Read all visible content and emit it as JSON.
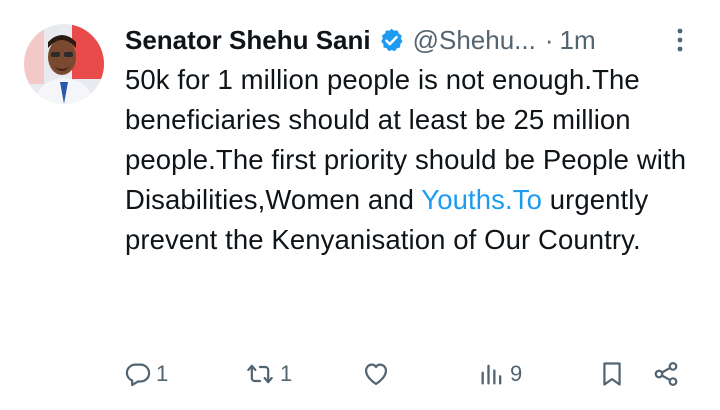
{
  "tweet": {
    "author_name": "Senator Shehu Sani",
    "handle": "@Shehu...",
    "separator": "·",
    "time": "1m",
    "text_parts": {
      "p1": "50k for 1 million people is not enough.The beneficiaries should at least be 25 million people.The first priority should be People with Disabilities,Women and ",
      "link": "Youths.To",
      "p2": " urgently prevent the Kenyanisation of Our Country."
    },
    "verified": true,
    "accent_color": "#1d9bf0"
  },
  "actions": {
    "reply_count": "1",
    "retweet_count": "1",
    "views_count": "9"
  },
  "icons": [
    "verified-badge-icon",
    "more-options-icon",
    "reply-icon",
    "retweet-icon",
    "like-icon",
    "views-icon",
    "bookmark-icon",
    "share-icon"
  ]
}
